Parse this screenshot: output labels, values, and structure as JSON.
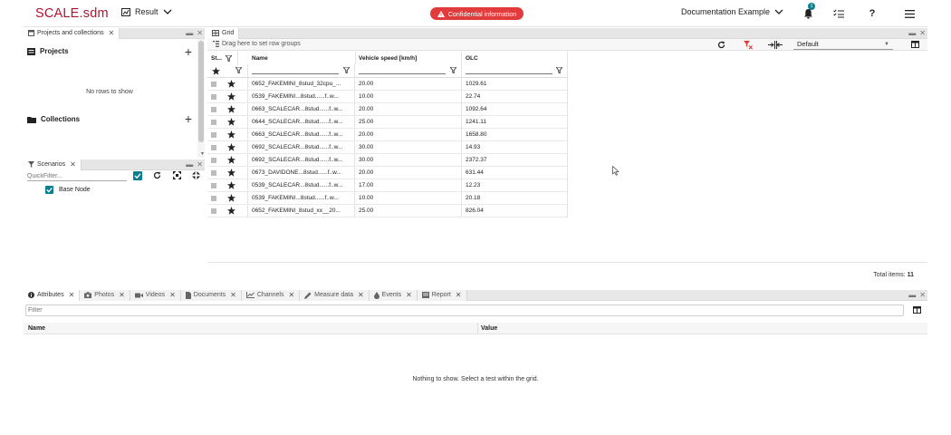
{
  "header": {
    "app_name": "SCALE.sdm",
    "view_menu": "Result",
    "confidential": "Confidential information",
    "project": "Documentation Example",
    "notification_count": "1",
    "help": "?"
  },
  "left_panel": {
    "tab": "Projects and collections",
    "projects_label": "Projects",
    "no_rows": "No rows to show",
    "collections_label": "Collections"
  },
  "scenarios": {
    "tab": "Scenarios",
    "quickfilter_placeholder": "QuickFilter...",
    "items": [
      {
        "label": "Base Node",
        "checked": true
      }
    ]
  },
  "grid": {
    "tab": "Grid",
    "drag_hint": "Drag here to set row groups",
    "layout_select": "Default",
    "columns": [
      "St...",
      "Name",
      "Vehicle speed [km/h]",
      "OLC"
    ],
    "rows": [
      {
        "name": "0652_FAKEMINI_8stud_32cpu_...",
        "speed": "20.00",
        "olc": "1029.61"
      },
      {
        "name": "0539_FAKEMINI...8stud......f..w...",
        "speed": "10.00",
        "olc": "22.74"
      },
      {
        "name": "0663_SCALECAR...8stud......f..w...",
        "speed": "20.00",
        "olc": "1092.64"
      },
      {
        "name": "0644_SCALECAR...8stud......f..w...",
        "speed": "25.00",
        "olc": "1241.11"
      },
      {
        "name": "0663_SCALECAR...8stud......f..w...",
        "speed": "20.00",
        "olc": "1658.80"
      },
      {
        "name": "0692_SCALECAR...8stud......f..w...",
        "speed": "30.00",
        "olc": "14.93"
      },
      {
        "name": "0692_SCALECAR...8stud......f..w...",
        "speed": "30.00",
        "olc": "2372.37"
      },
      {
        "name": "0673_DAVIDONE...8stud......f..w...",
        "speed": "20.00",
        "olc": "631.44"
      },
      {
        "name": "0539_SCALECAR...8stud......f..w...",
        "speed": "17.00",
        "olc": "12.23"
      },
      {
        "name": "0539_FAKEMINI...8stud......f..w...",
        "speed": "10.00",
        "olc": "20.18"
      },
      {
        "name": "0652_FAKEMINI_8stud_xx__20...",
        "speed": "25.00",
        "olc": "826.04"
      }
    ],
    "total_label": "Total items:",
    "total_value": "11"
  },
  "bottom": {
    "tabs": [
      "Attributes",
      "Photos",
      "Videos",
      "Documents",
      "Channels",
      "Measure data",
      "Events",
      "Report"
    ],
    "filter_placeholder": "Filter",
    "col_name": "Name",
    "col_value": "Value",
    "empty_message": "Nothing to show. Select a test within the grid."
  },
  "colors": {
    "brand": "#b0142f",
    "badge": "#e23b3b",
    "checkbox": "#0a7f8f",
    "filter_x": "#e23b3b"
  }
}
